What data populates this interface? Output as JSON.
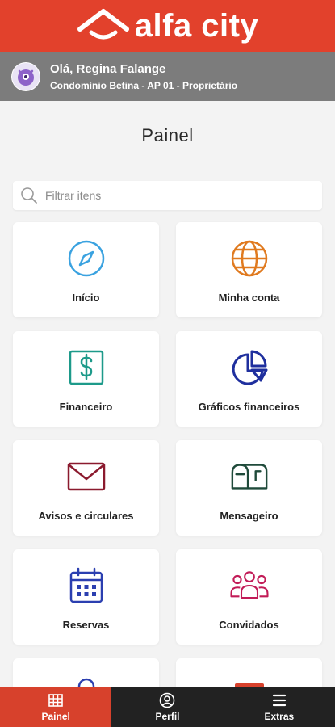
{
  "brand": {
    "name": "alfa city",
    "color": "#e2412c"
  },
  "user": {
    "greeting": "Olá, Regina Falange",
    "condo": "Condomínio Betina - AP 01 - Proprietário"
  },
  "page": {
    "title": "Painel"
  },
  "search": {
    "placeholder": "Filtrar itens"
  },
  "cards": [
    {
      "label": "Início",
      "icon": "compass-icon",
      "color": "#3aa2e0"
    },
    {
      "label": "Minha conta",
      "icon": "globe-icon",
      "color": "#e07a1f"
    },
    {
      "label": "Financeiro",
      "icon": "dollar-icon",
      "color": "#1d9a8a"
    },
    {
      "label": "Gráficos financeiros",
      "icon": "pie-chart-icon",
      "color": "#1f2f9e"
    },
    {
      "label": "Avisos e circulares",
      "icon": "envelope-icon",
      "color": "#8b1a2e"
    },
    {
      "label": "Mensageiro",
      "icon": "mailbox-icon",
      "color": "#1f4a3a"
    },
    {
      "label": "Reservas",
      "icon": "calendar-icon",
      "color": "#2b3fb0"
    },
    {
      "label": "Convidados",
      "icon": "guests-icon",
      "color": "#c21b57"
    },
    {
      "label": "",
      "icon": "person-icon",
      "color": "#2b3fb0"
    },
    {
      "label": "",
      "icon": "device-icon",
      "color": "#d7412c"
    }
  ],
  "nav": [
    {
      "label": "Painel",
      "icon": "grid-icon",
      "active": true
    },
    {
      "label": "Perfil",
      "icon": "profile-icon",
      "active": false
    },
    {
      "label": "Extras",
      "icon": "menu-icon",
      "active": false
    }
  ]
}
